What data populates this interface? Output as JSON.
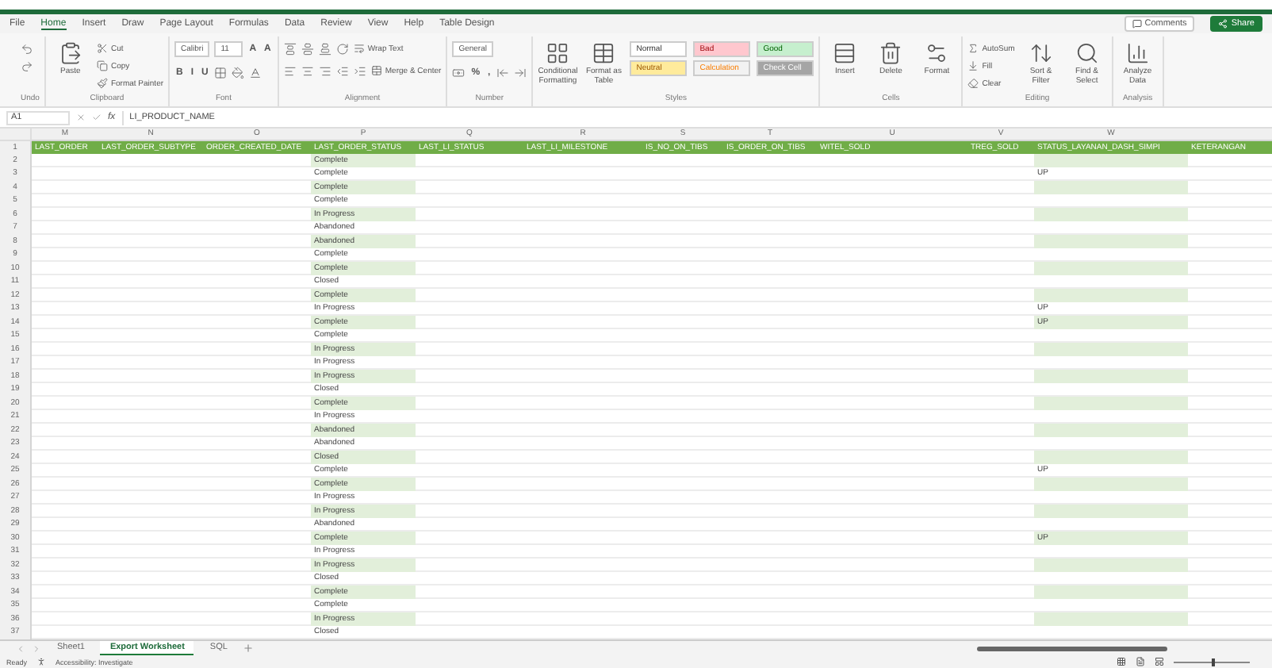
{
  "menu": {
    "tabs": [
      {
        "label": "File",
        "selected": false
      },
      {
        "label": "Home",
        "selected": true
      },
      {
        "label": "Insert",
        "selected": false
      },
      {
        "label": "Draw",
        "selected": false
      },
      {
        "label": "Page Layout",
        "selected": false
      },
      {
        "label": "Formulas",
        "selected": false
      },
      {
        "label": "Data",
        "selected": false
      },
      {
        "label": "Review",
        "selected": false
      },
      {
        "label": "View",
        "selected": false
      },
      {
        "label": "Help",
        "selected": false
      },
      {
        "label": "Table Design",
        "selected": false
      }
    ],
    "comments": "Comments",
    "share": "Share"
  },
  "ribbon": {
    "groups": [
      {
        "label": "Undo",
        "columns": [
          [
            {
              "kind": "icon"
            },
            {
              "kind": "icon"
            }
          ]
        ]
      },
      {
        "label": "Clipboard",
        "columns": [
          [
            {
              "kind": "big",
              "label": "Paste"
            }
          ],
          [
            {
              "kind": "small",
              "label": "Cut"
            },
            {
              "kind": "small",
              "label": "Copy"
            },
            {
              "kind": "small",
              "label": "Format Painter"
            }
          ]
        ]
      },
      {
        "label": "Font",
        "lines": [
          {
            "items": [
              {
                "kind": "field",
                "label": "Calibri"
              },
              {
                "kind": "field",
                "label": "11"
              },
              {
                "kind": "glyph",
                "label": "A"
              },
              {
                "kind": "glyph",
                "label": "A"
              }
            ]
          },
          {
            "items": [
              {
                "kind": "glyph",
                "label": "B"
              },
              {
                "kind": "glyph",
                "label": "I"
              },
              {
                "kind": "glyph",
                "label": "U"
              },
              {
                "kind": "icon"
              },
              {
                "kind": "icon"
              },
              {
                "kind": "icon"
              }
            ]
          }
        ]
      },
      {
        "label": "Alignment",
        "lines": [
          {
            "items": [
              {
                "kind": "icon"
              },
              {
                "kind": "icon"
              },
              {
                "kind": "icon"
              },
              {
                "kind": "icon"
              },
              {
                "kind": "small",
                "label": "Wrap Text"
              }
            ]
          },
          {
            "items": [
              {
                "kind": "icon"
              },
              {
                "kind": "icon"
              },
              {
                "kind": "icon"
              },
              {
                "kind": "icon"
              },
              {
                "kind": "icon"
              },
              {
                "kind": "small",
                "label": "Merge & Center"
              }
            ]
          }
        ]
      },
      {
        "label": "Number",
        "lines": [
          {
            "items": [
              {
                "kind": "field",
                "label": "General"
              }
            ]
          },
          {
            "items": [
              {
                "kind": "icon"
              },
              {
                "kind": "glyph",
                "label": "%"
              },
              {
                "kind": "glyph",
                "label": ","
              },
              {
                "kind": "icon"
              },
              {
                "kind": "icon"
              }
            ]
          }
        ]
      },
      {
        "label": "Styles",
        "columns": [
          [
            {
              "kind": "big",
              "label": "Conditional Formatting"
            }
          ],
          [
            {
              "kind": "big",
              "label": "Format as Table"
            }
          ],
          [
            {
              "kind": "style",
              "label": "Normal",
              "color": "#ffffff"
            },
            {
              "kind": "style",
              "label": "Neutral",
              "color": "#ffeb9c"
            }
          ],
          [
            {
              "kind": "style",
              "label": "Bad",
              "color": "#ffc7ce"
            },
            {
              "kind": "style",
              "label": "Calculation",
              "color": "#f2f2f2"
            }
          ],
          [
            {
              "kind": "style",
              "label": "Good",
              "color": "#c6efce"
            },
            {
              "kind": "style",
              "label": "Check Cell",
              "color": "#a5a5a5"
            }
          ]
        ]
      },
      {
        "label": "Cells",
        "columns": [
          [
            {
              "kind": "big",
              "label": "Insert"
            }
          ],
          [
            {
              "kind": "big",
              "label": "Delete"
            }
          ],
          [
            {
              "kind": "big",
              "label": "Format"
            }
          ]
        ]
      },
      {
        "label": "Editing",
        "columns": [
          [
            {
              "kind": "small",
              "label": "AutoSum"
            },
            {
              "kind": "small",
              "label": "Fill"
            },
            {
              "kind": "small",
              "label": "Clear"
            }
          ],
          [
            {
              "kind": "big",
              "label": "Sort & Filter"
            }
          ],
          [
            {
              "kind": "big",
              "label": "Find & Select"
            }
          ]
        ]
      },
      {
        "label": "Analysis",
        "columns": [
          [
            {
              "kind": "big",
              "label": "Analyze Data"
            }
          ]
        ]
      }
    ]
  },
  "formula_bar": {
    "name_box": "A1",
    "fx": "fx",
    "content": "LI_PRODUCT_NAME"
  },
  "sheet": {
    "columns": [
      {
        "letter": "M",
        "header": "LAST_ORDER",
        "filled": false
      },
      {
        "letter": "N",
        "header": "LAST_ORDER_SUBTYPE",
        "filled": false
      },
      {
        "letter": "O",
        "header": "ORDER_CREATED_DATE",
        "filled": false
      },
      {
        "letter": "P",
        "header": "LAST_ORDER_STATUS",
        "filled": true
      },
      {
        "letter": "Q",
        "header": "LAST_LI_STATUS",
        "filled": false
      },
      {
        "letter": "R",
        "header": "LAST_LI_MILESTONE",
        "filled": false
      },
      {
        "letter": "S",
        "header": "IS_NO_ON_TIBS",
        "filled": false
      },
      {
        "letter": "T",
        "header": "IS_ORDER_ON_TIBS",
        "filled": false
      },
      {
        "letter": "U",
        "header": "WITEL_SOLD",
        "filled": false
      },
      {
        "letter": "V",
        "header": "TREG_SOLD",
        "filled": false
      },
      {
        "letter": "W",
        "header": "STATUS_LAYANAN_DASH_SIMPI",
        "filled": true
      },
      {
        "header": "KETERANGAN",
        "filled": false
      }
    ],
    "header_row": "1",
    "rows": [
      {
        "n": "2",
        "cells": {
          "P": "Complete"
        }
      },
      {
        "n": "3",
        "cells": {
          "P": "Complete",
          "W": "UP"
        }
      },
      {
        "n": "4",
        "cells": {
          "P": "Complete"
        }
      },
      {
        "n": "5",
        "cells": {
          "P": "Complete"
        }
      },
      {
        "n": "6",
        "cells": {
          "P": "In Progress"
        }
      },
      {
        "n": "7",
        "cells": {
          "P": "Abandoned"
        }
      },
      {
        "n": "8",
        "cells": {
          "P": "Abandoned"
        }
      },
      {
        "n": "9",
        "cells": {
          "P": "Complete"
        }
      },
      {
        "n": "10",
        "cells": {
          "P": "Complete"
        }
      },
      {
        "n": "11",
        "cells": {
          "P": "Closed"
        }
      },
      {
        "n": "12",
        "cells": {
          "P": "Complete"
        }
      },
      {
        "n": "13",
        "cells": {
          "P": "In Progress",
          "W": "UP"
        }
      },
      {
        "n": "14",
        "cells": {
          "P": "Complete",
          "W": "UP"
        }
      },
      {
        "n": "15",
        "cells": {
          "P": "Complete"
        }
      },
      {
        "n": "16",
        "cells": {
          "P": "In Progress"
        }
      },
      {
        "n": "17",
        "cells": {
          "P": "In Progress"
        }
      },
      {
        "n": "18",
        "cells": {
          "P": "In Progress"
        }
      },
      {
        "n": "19",
        "cells": {
          "P": "Closed"
        }
      },
      {
        "n": "20",
        "cells": {
          "P": "Complete"
        }
      },
      {
        "n": "21",
        "cells": {
          "P": "In Progress"
        }
      },
      {
        "n": "22",
        "cells": {
          "P": "Abandoned"
        }
      },
      {
        "n": "23",
        "cells": {
          "P": "Abandoned"
        }
      },
      {
        "n": "24",
        "cells": {
          "P": "Closed"
        }
      },
      {
        "n": "25",
        "cells": {
          "P": "Complete",
          "W": "UP"
        }
      },
      {
        "n": "26",
        "cells": {
          "P": "Complete"
        }
      },
      {
        "n": "27",
        "cells": {
          "P": "In Progress"
        }
      },
      {
        "n": "28",
        "cells": {
          "P": "In Progress"
        }
      },
      {
        "n": "29",
        "cells": {
          "P": "Abandoned"
        }
      },
      {
        "n": "30",
        "cells": {
          "P": "Complete",
          "W": "UP"
        }
      },
      {
        "n": "31",
        "cells": {
          "P": "In Progress"
        }
      },
      {
        "n": "32",
        "cells": {
          "P": "In Progress"
        }
      },
      {
        "n": "33",
        "cells": {
          "P": "Closed"
        }
      },
      {
        "n": "34",
        "cells": {
          "P": "Complete"
        }
      },
      {
        "n": "35",
        "cells": {
          "P": "Complete"
        }
      },
      {
        "n": "36",
        "cells": {
          "P": "In Progress"
        }
      },
      {
        "n": "37",
        "cells": {
          "P": "Closed"
        }
      }
    ]
  },
  "sheet_tabs": [
    {
      "label": "Sheet1",
      "selected": false
    },
    {
      "label": "Export Worksheet",
      "selected": true
    },
    {
      "label": "SQL",
      "selected": false
    }
  ],
  "status_bar": {
    "ready": "Ready",
    "accessibility": "Accessibility: Investigate",
    "zoom": {
      "level": 0.5
    }
  }
}
